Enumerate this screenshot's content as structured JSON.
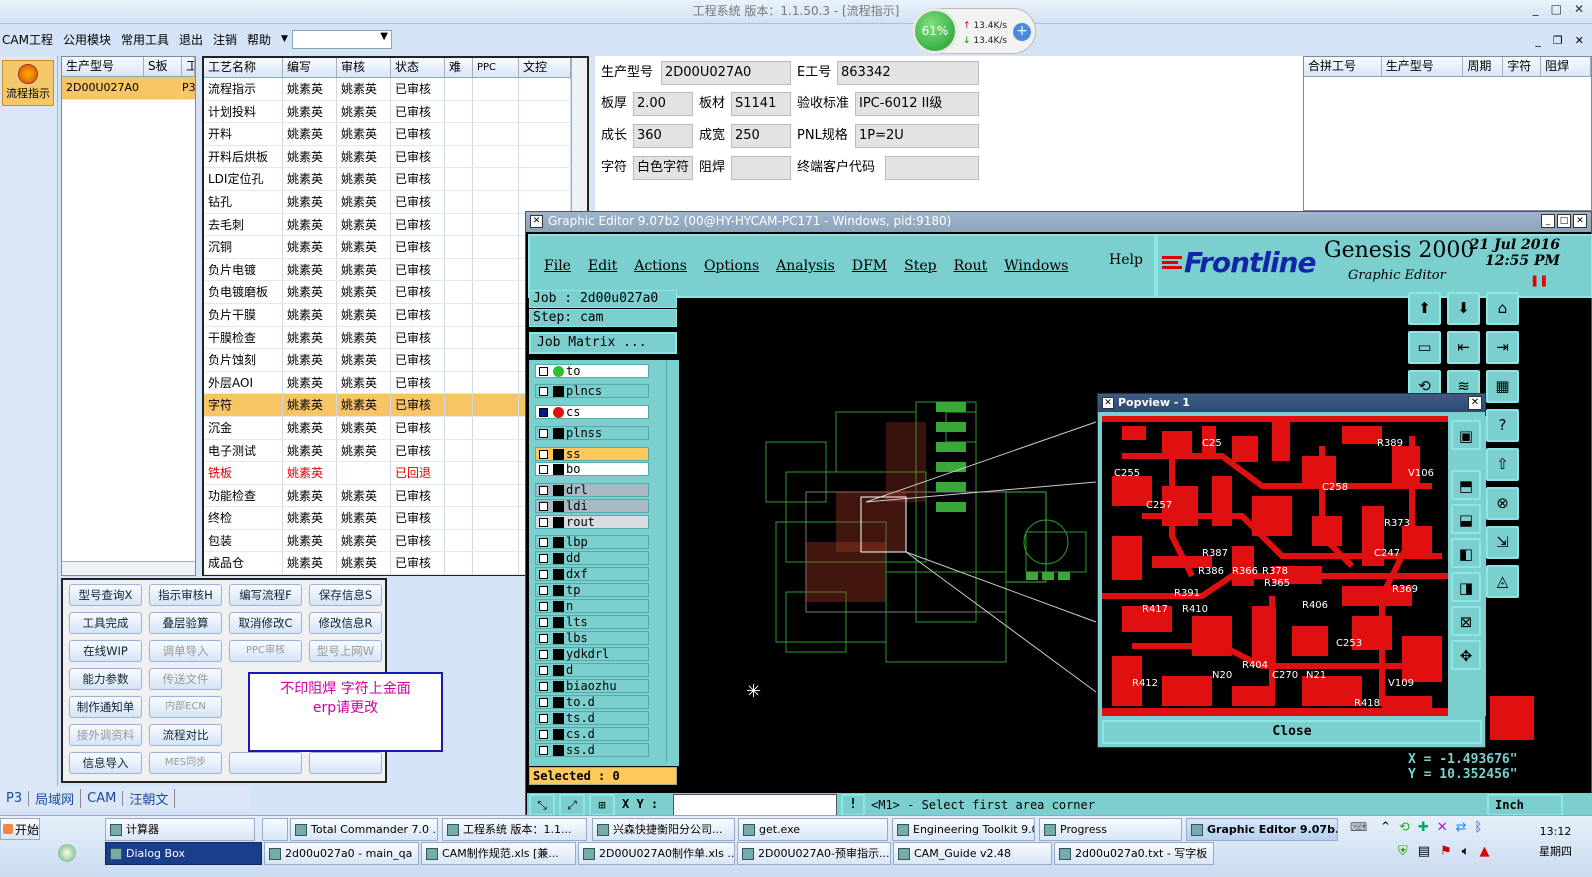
{
  "window": {
    "title": "工程系统  版本：1.1.50.3 - [流程指示]"
  },
  "menu": {
    "items": [
      "CAM工程",
      "公用模块",
      "常用工具",
      "退出",
      "注销",
      "帮助"
    ],
    "dropdown_value": ""
  },
  "netmon": {
    "percent": "61%",
    "up": "13.4K/s",
    "down": "13.4K/s"
  },
  "leftnav": {
    "label": "流程指示"
  },
  "list1": {
    "headers": [
      "生产型号",
      "S板",
      "工"
    ],
    "rows": [
      [
        "2D00U027A0",
        "",
        "P3"
      ]
    ]
  },
  "list2": {
    "headers": [
      "工艺名称",
      "编写",
      "审核",
      "状态",
      "难",
      "PPC",
      "文控"
    ],
    "rows": [
      [
        "流程指示",
        "姚素英",
        "姚素英",
        "已审核"
      ],
      [
        "计划投料",
        "姚素英",
        "姚素英",
        "已审核"
      ],
      [
        "开料",
        "姚素英",
        "姚素英",
        "已审核"
      ],
      [
        "开料后烘板",
        "姚素英",
        "姚素英",
        "已审核"
      ],
      [
        "LDI定位孔",
        "姚素英",
        "姚素英",
        "已审核"
      ],
      [
        "钻孔",
        "姚素英",
        "姚素英",
        "已审核"
      ],
      [
        "去毛刺",
        "姚素英",
        "姚素英",
        "已审核"
      ],
      [
        "沉铜",
        "姚素英",
        "姚素英",
        "已审核"
      ],
      [
        "负片电镀",
        "姚素英",
        "姚素英",
        "已审核"
      ],
      [
        "负电镀磨板",
        "姚素英",
        "姚素英",
        "已审核"
      ],
      [
        "负片干膜",
        "姚素英",
        "姚素英",
        "已审核"
      ],
      [
        "干膜检查",
        "姚素英",
        "姚素英",
        "已审核"
      ],
      [
        "负片蚀刻",
        "姚素英",
        "姚素英",
        "已审核"
      ],
      [
        "外层AOI",
        "姚素英",
        "姚素英",
        "已审核"
      ],
      [
        "字符",
        "姚素英",
        "姚素英",
        "已审核"
      ],
      [
        "沉金",
        "姚素英",
        "姚素英",
        "已审核"
      ],
      [
        "电子测试",
        "姚素英",
        "姚素英",
        "已审核"
      ],
      [
        "铣板",
        "姚素英",
        "",
        "已回退"
      ],
      [
        "功能检查",
        "姚素英",
        "姚素英",
        "已审核"
      ],
      [
        "终检",
        "姚素英",
        "姚素英",
        "已审核"
      ],
      [
        "包装",
        "姚素英",
        "姚素英",
        "已审核"
      ],
      [
        "成品仓",
        "姚素英",
        "姚素英",
        "已审核"
      ]
    ]
  },
  "buttons": {
    "b1": "型号查询X",
    "b2": "指示审核H",
    "b3": "编写流程F",
    "b4": "保存信息S",
    "b5": "工具完成",
    "b6": "叠层验算",
    "b7": "取消修改C",
    "b8": "修改信息R",
    "b9": "在线WIP",
    "b10": "调单导入",
    "b11": "PPC审核",
    "b12": "型号上网W",
    "b13": "能力参数",
    "b14": "传送文件",
    "b15": "制作通知单",
    "b16": "内部ECN",
    "b17": "接外调资料",
    "b18": "流程对比",
    "b19": "信息导入",
    "b20": "MES同步"
  },
  "note": {
    "line1": "不印阻焊   字符上金面",
    "line2": "erp请更改"
  },
  "bottomtabs": [
    "P3",
    "局域网",
    "CAM",
    "汪朝文"
  ],
  "form": {
    "l_model": "生产型号",
    "model": "2D00U027A0",
    "l_eno": "E工号",
    "eno": "863342",
    "l_thick": "板厚",
    "thick": "2.00",
    "l_mat": "板材",
    "mat": "S1141",
    "l_std": "验收标准",
    "std": "IPC-6012 II级",
    "l_len": "成长",
    "len": "360",
    "l_wid": "成宽",
    "wid": "250",
    "l_pnl": "PNL规格",
    "pnl": "1P=2U",
    "l_char": "字符",
    "char": "白色字符",
    "l_mask": "阻焊",
    "mask": "",
    "l_cust": "终端客户代码",
    "cust": ""
  },
  "rgrid": {
    "headers": [
      "合拼工号",
      "生产型号",
      "周期",
      "字符",
      "阻焊"
    ]
  },
  "ge": {
    "title": "Graphic Editor 9.07b2 (00@HY-HYCAM-PC171 - Windows, pid:9180)",
    "menu": [
      "File",
      "Edit",
      "Actions",
      "Options",
      "Analysis",
      "DFM",
      "Step",
      "Rout",
      "Windows"
    ],
    "help": "Help",
    "brand": "Frontline",
    "product": "Genesis 2000",
    "sub": "Graphic Editor",
    "date": "21 Jul 2016",
    "time": "12:55 PM",
    "job": "Job : 2d00u027a0",
    "step": "Step: cam",
    "matrix": "Job Matrix ...",
    "layers": [
      "to",
      "plncs",
      "cs",
      "plnss",
      "ss",
      "bo",
      "drl",
      "ldi",
      "rout",
      "lbp",
      "dd",
      "dxf",
      "tp",
      "n",
      "lts",
      "lbs",
      "ydkdrl",
      "d",
      "biaozhu",
      "to.d",
      "ts.d",
      "cs.d",
      "ss.d"
    ],
    "selected": "Selected : 0",
    "popup_title": "Popview - 1",
    "popup_close": "Close",
    "x": "X = -1.493676\"",
    "y": "Y = 10.352456\"",
    "xy_label": "X Y :",
    "prompt": "<M1> - Select first area corner",
    "inch": "Inch",
    "pcb_labels": [
      "C255",
      "C25",
      "R389",
      "V106",
      "C258",
      "C257",
      "R373",
      "R387",
      "R386",
      "R366",
      "R378",
      "R365",
      "C247",
      "R391",
      "R417",
      "R410",
      "R406",
      "C253",
      "R369",
      "R404",
      "C270",
      "N20",
      "N21",
      "R412",
      "V109",
      "R418"
    ]
  },
  "taskbar": {
    "start": "开始",
    "row1": [
      "计算器",
      "",
      "Total Commander 7.0 ...",
      "工程系统  版本：1.1...",
      "兴森快捷衡阳分公司...",
      "get.exe",
      "Engineering Toolkit 9.0...",
      "Progress",
      "Graphic Editor 9.07b..."
    ],
    "row2": [
      "Dialog Box",
      "2d00u027a0 - main_qa",
      "CAM制作规范.xls [兼...",
      "2D00U027A0制作单.xls ...",
      "2D00U027A0-预审指示...",
      "CAM_Guide v2.48",
      "2d00u027a0.txt - 写字板"
    ],
    "time": "13:12",
    "day": "星期四"
  }
}
